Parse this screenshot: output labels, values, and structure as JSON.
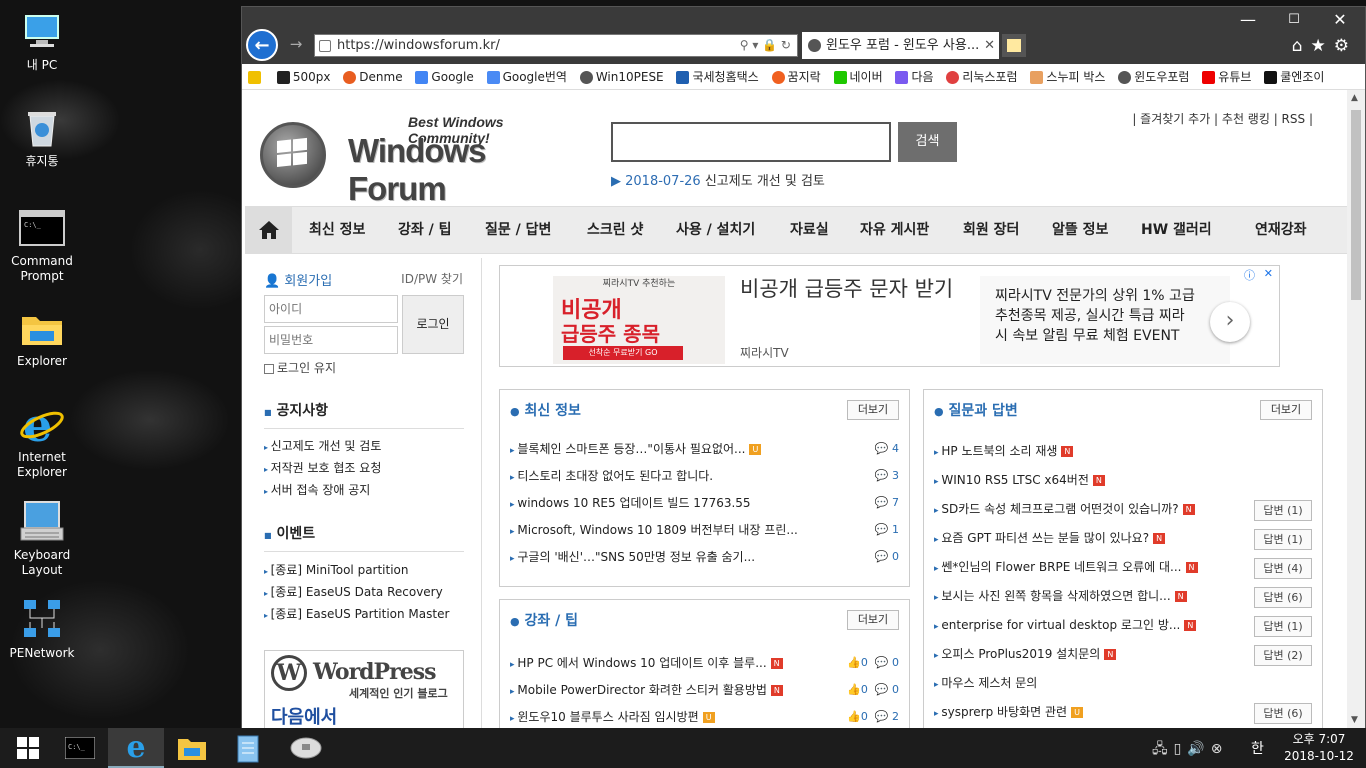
{
  "desktop": {
    "icons": [
      {
        "label": "내 PC"
      },
      {
        "label": "휴지통"
      },
      {
        "label": "Command\nPrompt"
      },
      {
        "label": "Explorer"
      },
      {
        "label": "Internet\nExplorer"
      },
      {
        "label": "Keyboard\nLayout"
      },
      {
        "label": "PENetwork"
      }
    ]
  },
  "browser": {
    "url": "https://windowsforum.kr/",
    "tab_title": "윈도우 포럼 - 윈도우 사용...",
    "favorites": [
      "500px",
      "Denme",
      "Google",
      "Google번역",
      "Win10PESE",
      "국세청홈택스",
      "꿈지락",
      "네이버",
      "다음",
      "리눅스포럼",
      "스누피 박스",
      "윈도우포럼",
      "유튜브",
      "쿨엔조이"
    ]
  },
  "site": {
    "logo_tagline": "Best Windows Community!",
    "logo_text": "Windows Forum",
    "search_button": "검색",
    "notice_date": "2018-07-26",
    "notice_text": "신고제도 개선 및 검토",
    "toplinks": "|  즐겨찾기 추가  |  추천 랭킹  |  RSS  |",
    "menu": [
      "최신 정보",
      "강좌 / 팁",
      "질문 / 답변",
      "스크린 샷",
      "사용 / 설치기",
      "자료실",
      "자유 게시판",
      "회원 장터",
      "알뜰 정보",
      "HW 갤러리",
      "연재강좌"
    ],
    "login": {
      "join": "회원가입",
      "find": "ID/PW 찾기",
      "id_placeholder": "아이디",
      "pw_placeholder": "비밀번호",
      "button": "로그인",
      "keep": "로그인 유지"
    },
    "notices_title": "공지사항",
    "notices": [
      "신고제도 개선 및 검토",
      "저작권 보호 협조 요청",
      "서버 접속 장애 공지"
    ],
    "events_title": "이벤트",
    "events": [
      "[종료] MiniTool partition",
      "[종료] EaseUS Data Recovery",
      "[종료] EaseUS Partition Master"
    ],
    "wp_banner": {
      "title": "WordPress",
      "subtitle": "세계적인 인기 블로그",
      "extra": "다음에서"
    },
    "ad": {
      "img_top": "찌라시TV 추천하는",
      "img_main1": "비공개",
      "img_main2": "급등주 종목",
      "img_sub": "선착순 무료받기 GO",
      "title": "비공개 급등주 문자 받기",
      "source": "찌라시TV",
      "desc": "찌라시TV 전문가의 상위 1% 고급 추천종목 제공, 실시간 특급 찌라시 속보 알림 무료 체험 EVENT"
    },
    "more_label": "더보기",
    "latest": {
      "title": "최신 정보",
      "items": [
        {
          "text": "블록체인 스마트폰 등장…\"이통사 필요없어...",
          "badge": "U",
          "count": "4"
        },
        {
          "text": "티스토리 초대장 없어도 된다고 합니다.",
          "badge": "",
          "count": "3"
        },
        {
          "text": "windows 10 RE5 업데이트 빌드 17763.55",
          "badge": "",
          "count": "7"
        },
        {
          "text": "Microsoft, Windows 10 1809 버전부터 내장 프린...",
          "badge": "",
          "count": "1"
        },
        {
          "text": "구글의 '배신'…\"SNS 50만명 정보 유출 숨기...",
          "badge": "",
          "count": "0"
        }
      ]
    },
    "tips": {
      "title": "강좌 / 팁",
      "items": [
        {
          "text": "HP PC 에서 Windows 10 업데이트 이후 블루...",
          "badge": "N",
          "likes": "0",
          "count": "0"
        },
        {
          "text": "Mobile PowerDirector 화려한 스티커 활용방법",
          "badge": "N",
          "likes": "0",
          "count": "0"
        },
        {
          "text": "윈도우10 블루투스 사라짐 임시방편",
          "badge": "U",
          "likes": "0",
          "count": "2"
        }
      ]
    },
    "qa": {
      "title": "질문과 답변",
      "items": [
        {
          "text": "HP 노트북의 소리 재생",
          "badge": "N",
          "ans": ""
        },
        {
          "text": "WIN10 RS5 LTSC x64버전",
          "badge": "N",
          "ans": ""
        },
        {
          "text": "SD카드 속성 체크프로그램 어떤것이 있습니까?",
          "badge": "N",
          "ans": "답변 (1)"
        },
        {
          "text": "요즘 GPT 파티션 쓰는 분들 많이 있나요?",
          "badge": "N",
          "ans": "답변 (1)"
        },
        {
          "text": "쎈*인님의 Flower BRPE 네트워크 오류에 대...",
          "badge": "N",
          "ans": "답변 (4)"
        },
        {
          "text": "보시는 사진 왼쪽 항목을 삭제하였으면 합니...",
          "badge": "N",
          "ans": "답변 (6)"
        },
        {
          "text": "enterprise for virtual desktop 로그인 방...",
          "badge": "N",
          "ans": "답변 (1)"
        },
        {
          "text": "오피스 ProPlus2019 설치문의",
          "badge": "N",
          "ans": "답변 (2)"
        },
        {
          "text": "마우스 제스처 문의",
          "badge": "",
          "ans": ""
        },
        {
          "text": "sysprerp 바탕화면 관련",
          "badge": "U",
          "ans": "답변 (6)"
        }
      ]
    }
  },
  "taskbar": {
    "time": "오후 7:07",
    "date": "2018-10-12",
    "ime": "한"
  }
}
